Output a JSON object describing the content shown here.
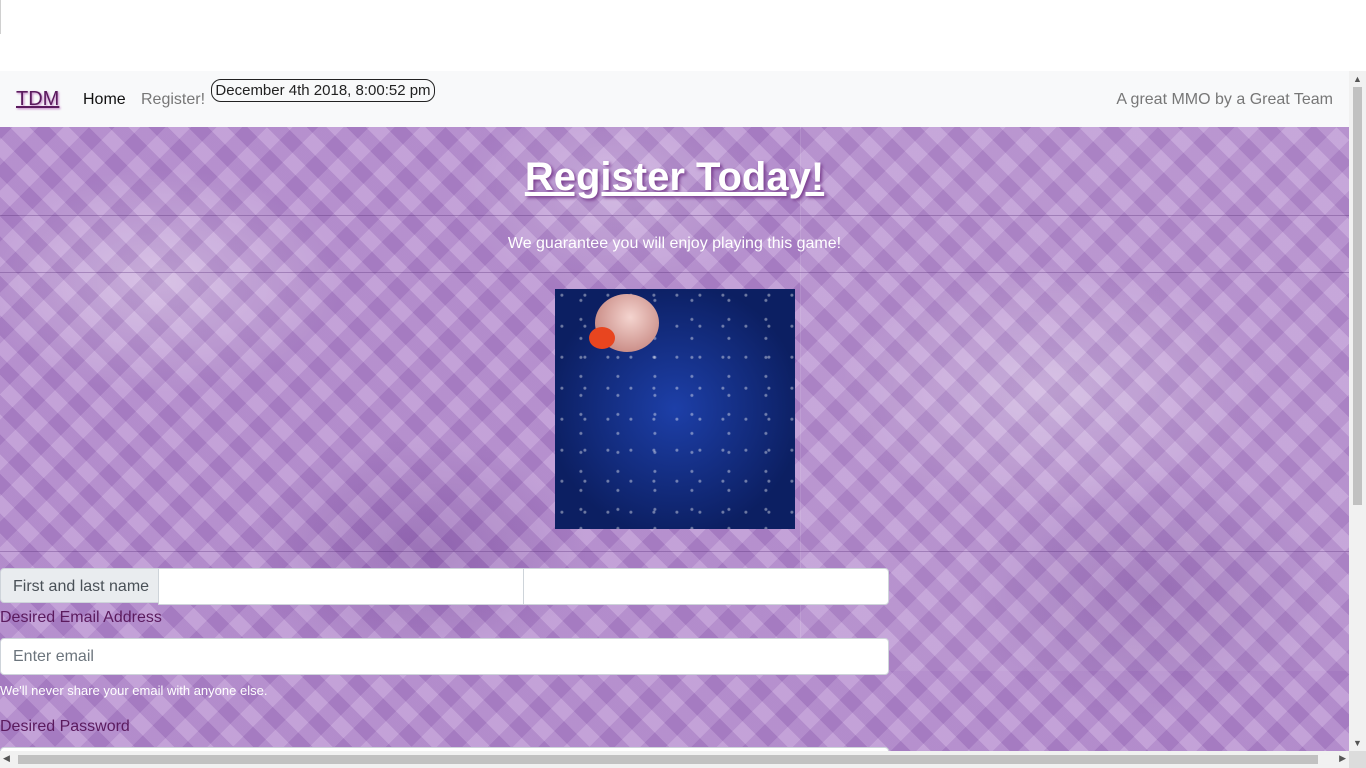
{
  "navbar": {
    "brand": "TDM",
    "home": "Home",
    "register": "Register!",
    "clock": "December 4th 2018, 8:00:52 pm",
    "tagline": "A great MMO by a Great Team"
  },
  "hero": {
    "title": "Register Today!",
    "subtitle": "We guarantee you will enjoy playing this game!"
  },
  "animation": {
    "icon": "game-character-gif"
  },
  "form": {
    "name_label": "First and last name",
    "first_name_value": "",
    "last_name_value": "",
    "email_label": "Desired Email Address",
    "email_placeholder": "Enter email",
    "email_value": "",
    "email_help": "We'll never share your email with anyone else.",
    "password_label": "Desired Password"
  },
  "scrollbars": {
    "up_icon": "▲",
    "down_icon": "▼",
    "left_icon": "◀",
    "right_icon": "▶"
  }
}
